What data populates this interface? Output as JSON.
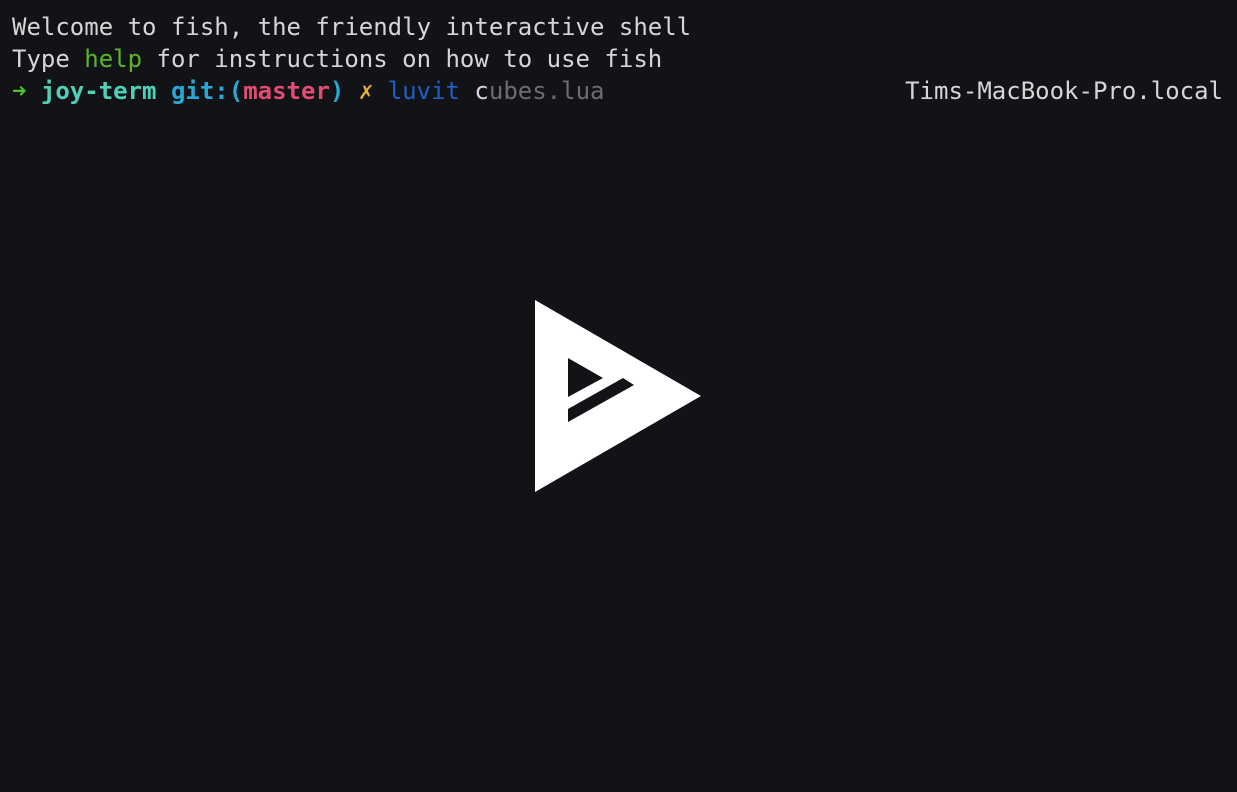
{
  "terminal": {
    "welcome": "Welcome to fish, the friendly interactive shell",
    "help_prefix": "Type ",
    "help_word": "help",
    "help_suffix": " for instructions on how to use fish",
    "prompt": {
      "arrow": "➜",
      "directory": "joy-term",
      "git_label": "git:",
      "paren_open": "(",
      "branch": "master",
      "paren_close": ")",
      "dirty_mark": "✗",
      "command": "luvit",
      "typed": "c",
      "autosuggestion": "ubes.lua",
      "hostname": "Tims-MacBook-Pro.local"
    }
  },
  "colors": {
    "background": "#121316",
    "foreground": "#d6d6d6",
    "help": "#5ab52a",
    "arrow": "#4fc22f",
    "directory": "#4fd1b8",
    "git": "#29a8d6",
    "branch": "#e14b74",
    "dirty": "#e8b23a",
    "command": "#1f5fc6",
    "suggestion": "#6d6d6d"
  },
  "overlay": {
    "icon": "play-logo-icon"
  }
}
